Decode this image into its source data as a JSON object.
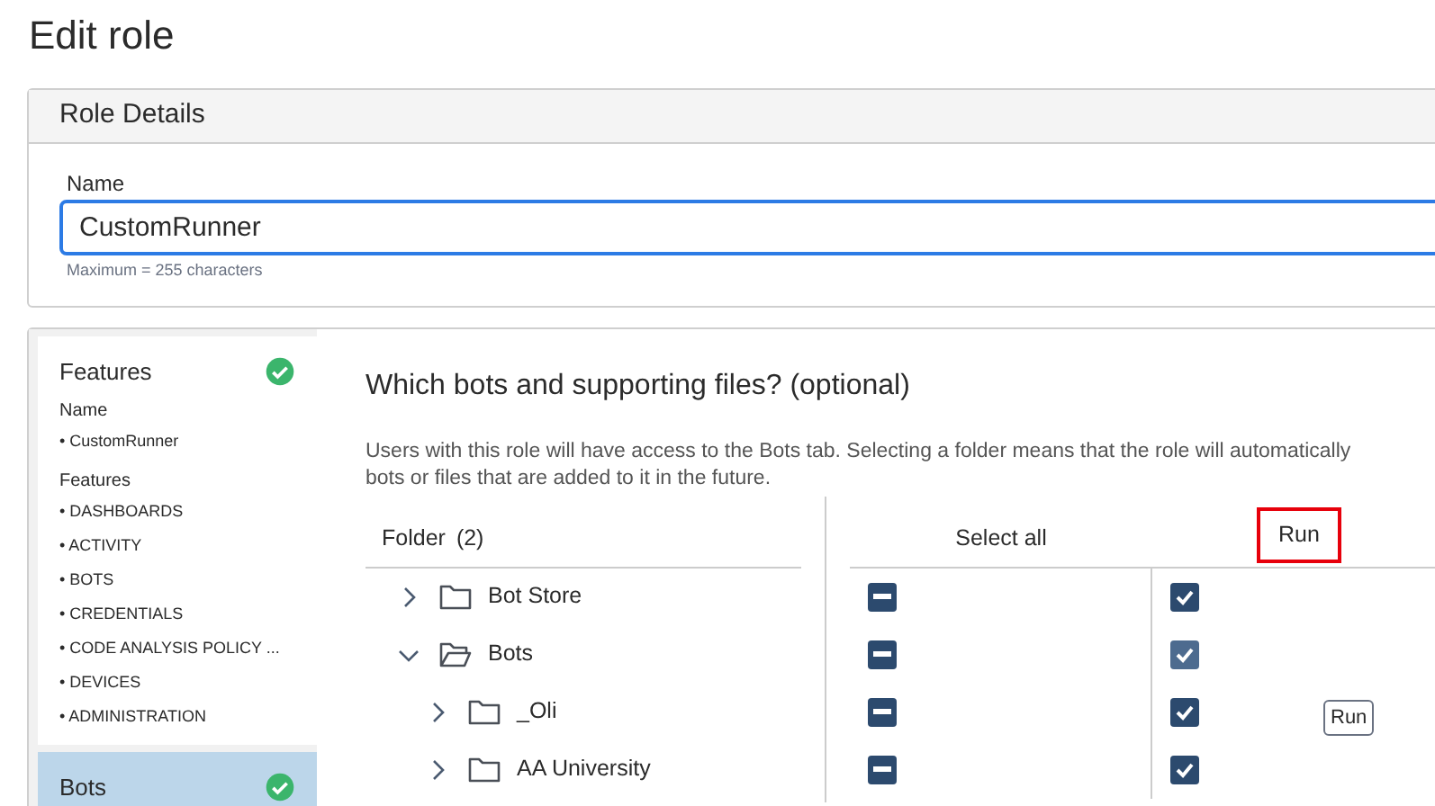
{
  "page_title": "Edit role",
  "role_details": {
    "title": "Role Details",
    "name_field": {
      "label": "Name",
      "value": "CustomRunner",
      "hint": "Maximum = 255 characters"
    }
  },
  "sidebar": {
    "steps": [
      {
        "title": "Features",
        "complete": true,
        "selected": false,
        "sections": [
          {
            "heading": "Name",
            "items": [
              "• CustomRunner"
            ]
          },
          {
            "heading": "Features",
            "items": [
              "• DASHBOARDS",
              "• ACTIVITY",
              "• BOTS",
              "• CREDENTIALS",
              "• CODE ANALYSIS POLICY ...",
              "• DEVICES",
              "• ADMINISTRATION"
            ]
          }
        ]
      },
      {
        "title": "Bots",
        "complete": true,
        "selected": true
      }
    ]
  },
  "bots_section": {
    "heading": "Which bots and supporting files? (optional)",
    "description_lines": [
      "Users with this role will have access to the Bots tab. Selecting a folder means that the role will automatically",
      "bots or files that are added to it in the future."
    ],
    "columns": [
      {
        "label": "Folder",
        "count": "(2)",
        "highlighted": false
      },
      {
        "label": "Select all",
        "highlighted": false
      },
      {
        "label": "Run",
        "highlighted": true
      }
    ],
    "rows": [
      {
        "name": "Bot Store",
        "expanded": false,
        "select_all_indeterminate": true,
        "run_checked": true,
        "hovered": false
      },
      {
        "name": "Bots",
        "expanded": true,
        "select_all_indeterminate": true,
        "run_checked": true,
        "hovered": true,
        "children": [
          {
            "name": "_Oli",
            "expanded": false,
            "select_all_indeterminate": true,
            "run_checked": true,
            "hovered": false
          },
          {
            "name": "AA University",
            "expanded": false,
            "select_all_indeterminate": true,
            "run_checked": true,
            "hovered": false
          }
        ]
      }
    ],
    "tooltip": "Run"
  }
}
